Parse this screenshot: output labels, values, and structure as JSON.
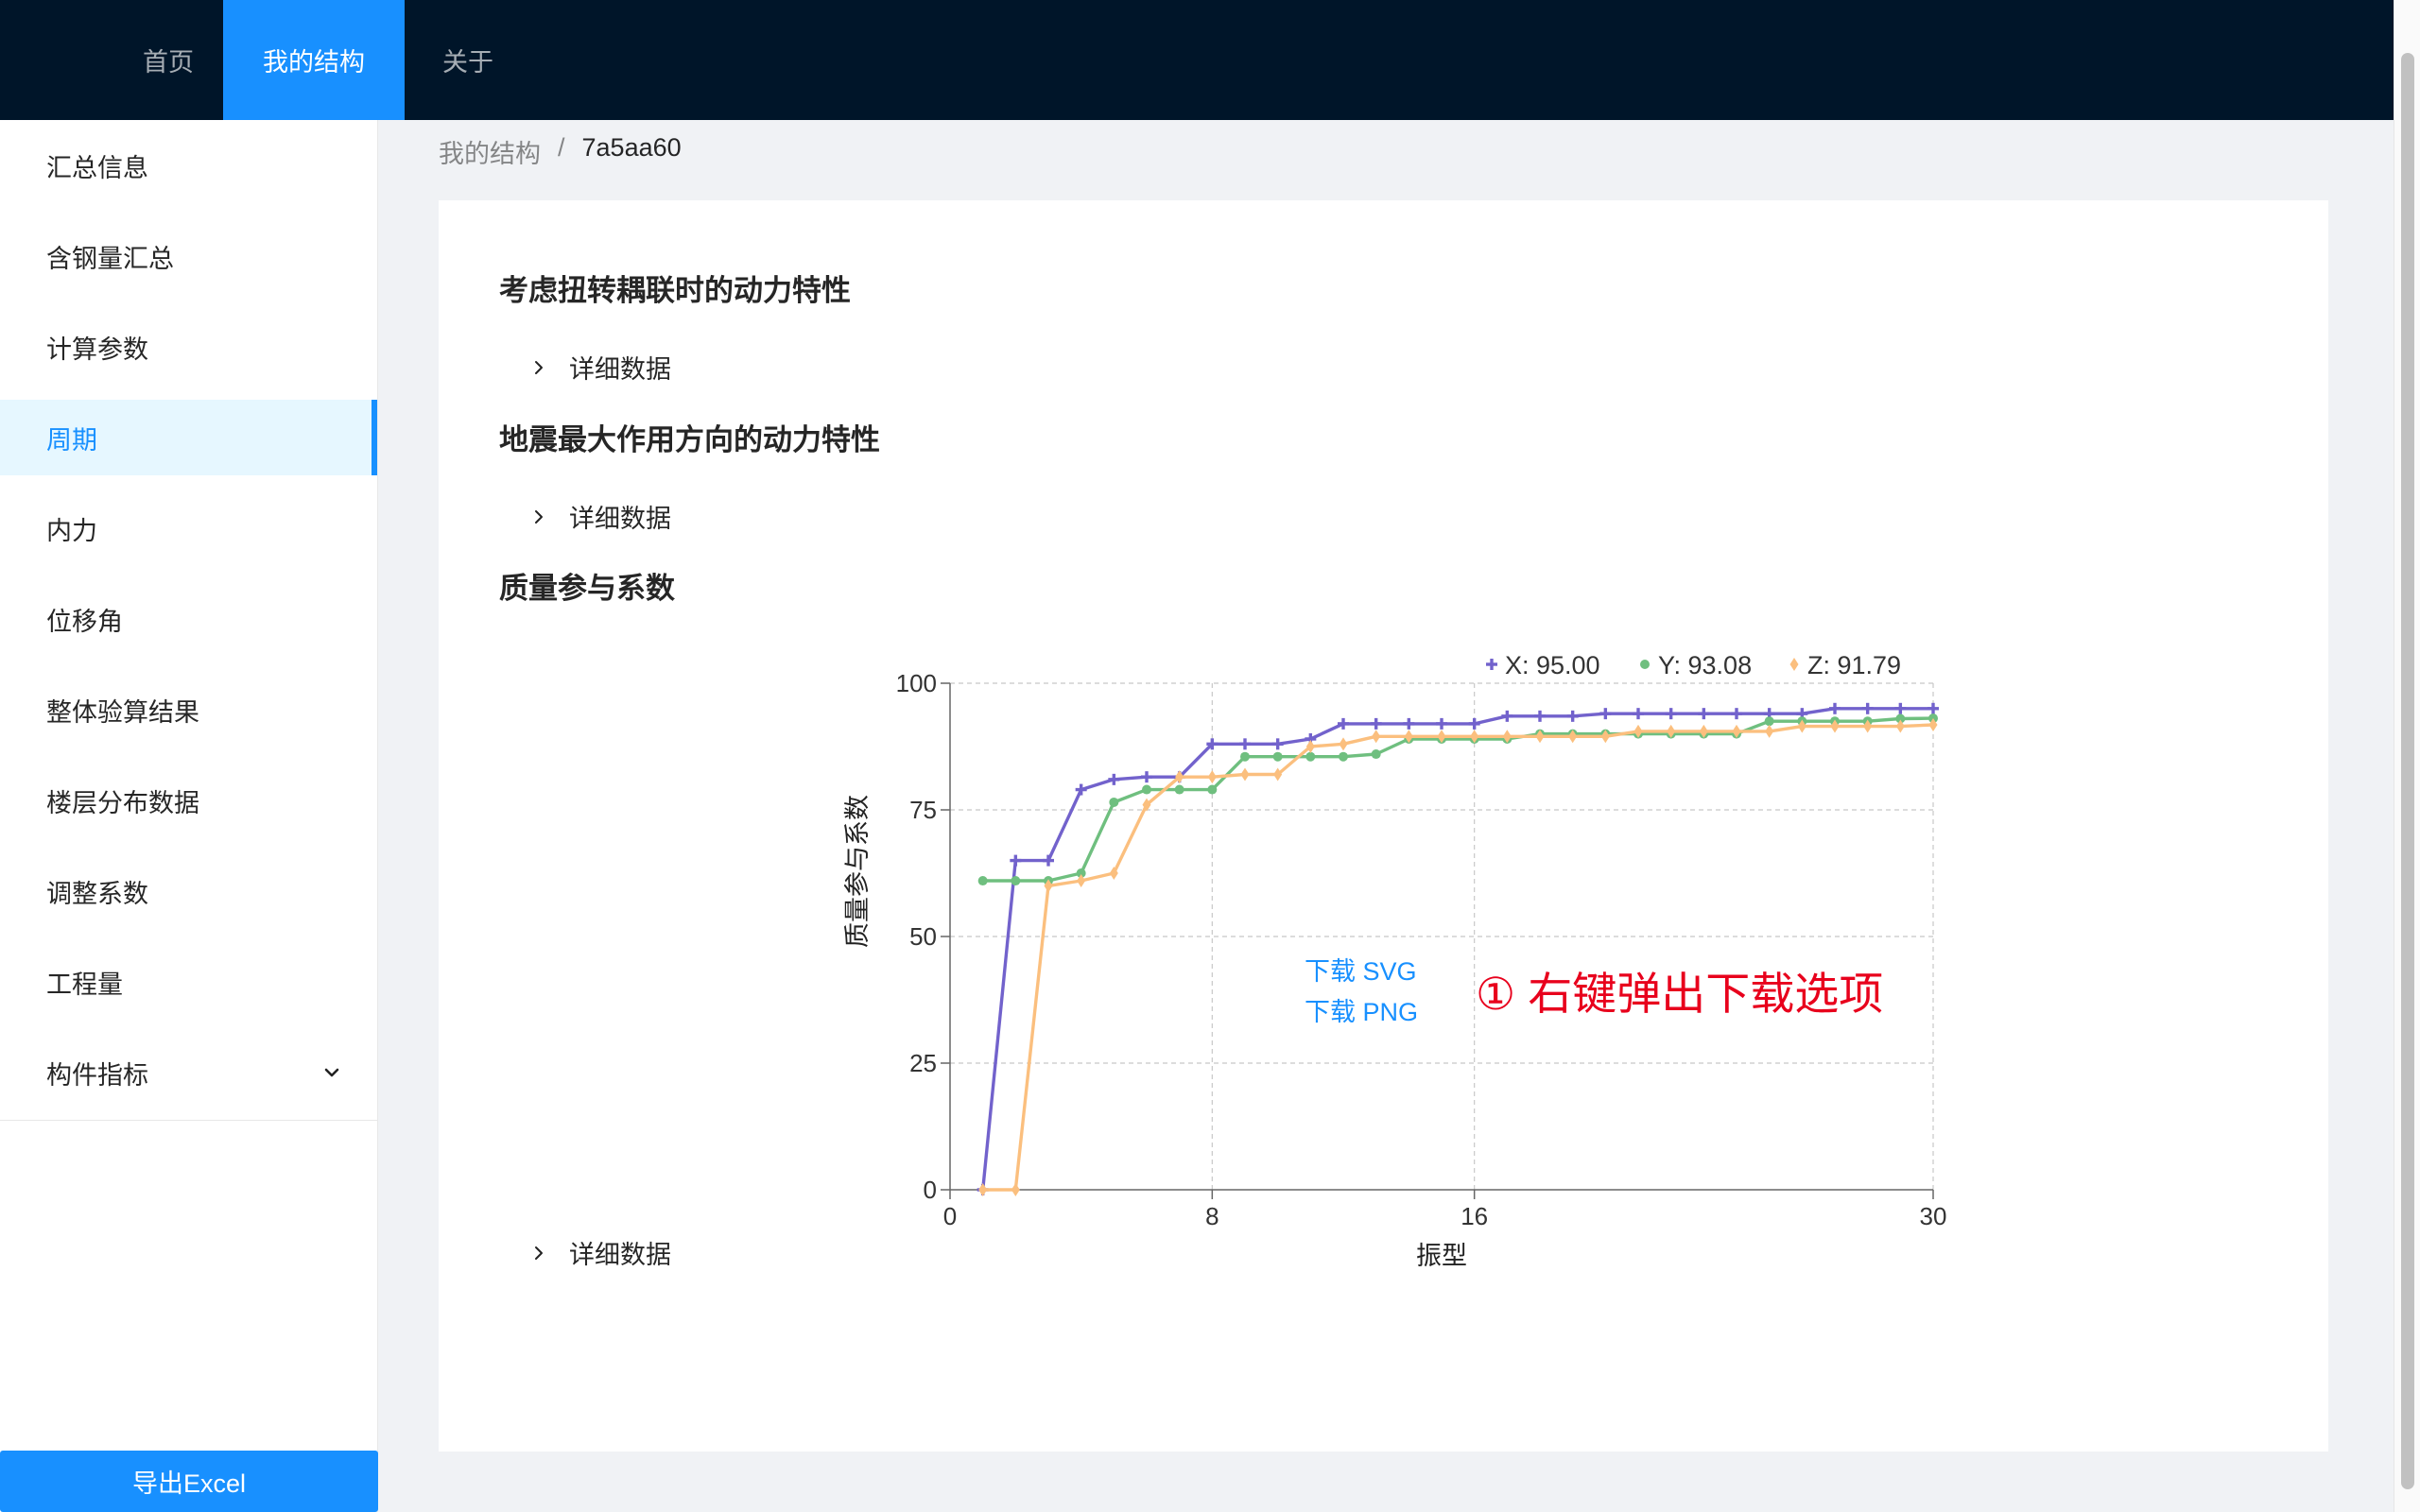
{
  "nav": {
    "home": "首页",
    "my_structure": "我的结构",
    "about": "关于"
  },
  "sidebar": {
    "items": [
      {
        "label": "汇总信息"
      },
      {
        "label": "含钢量汇总"
      },
      {
        "label": "计算参数"
      },
      {
        "label": "周期",
        "active": true
      },
      {
        "label": "内力"
      },
      {
        "label": "位移角"
      },
      {
        "label": "整体验算结果"
      },
      {
        "label": "楼层分布数据"
      },
      {
        "label": "调整系数"
      },
      {
        "label": "工程量"
      },
      {
        "label": "构件指标",
        "expandable": true
      }
    ],
    "export_label": "导出Excel"
  },
  "breadcrumb": {
    "parent": "我的结构",
    "separator": "/",
    "current": "7a5aa60"
  },
  "sections": [
    {
      "title": "考虑扭转耦联时的动力特性",
      "detail_label": "详细数据"
    },
    {
      "title": "地震最大作用方向的动力特性",
      "detail_label": "详细数据"
    },
    {
      "title": "质量参与系数",
      "detail_label": "详细数据"
    }
  ],
  "context_menu": {
    "download_svg": "下载 SVG",
    "download_png": "下载 PNG"
  },
  "annotation": "① 右键弹出下载选项",
  "colors": {
    "nav_bg": "#001529",
    "accent": "#1890ff",
    "series_x": "#7262cc",
    "series_y": "#6fbf7f",
    "series_z": "#fbbf7e",
    "annotation": "#e8001c"
  },
  "chart_data": {
    "type": "line",
    "xlabel": "振型",
    "ylabel": "质量参与系数",
    "xlim": [
      0,
      30
    ],
    "ylim": [
      0,
      100
    ],
    "x_ticks": [
      0,
      8,
      16,
      30
    ],
    "y_ticks": [
      0,
      25,
      50,
      75,
      100
    ],
    "grid": true,
    "legend_position": "top-right",
    "x": [
      1,
      2,
      3,
      4,
      5,
      6,
      7,
      8,
      9,
      10,
      11,
      12,
      13,
      14,
      15,
      16,
      17,
      18,
      19,
      20,
      21,
      22,
      23,
      24,
      25,
      26,
      27,
      28,
      29,
      30
    ],
    "series": [
      {
        "name": "X",
        "legend_label": "X: 95.00",
        "marker": "cross",
        "values": [
          0,
          65,
          65,
          79,
          81,
          81.5,
          81.5,
          88,
          88,
          88,
          89,
          92,
          92,
          92,
          92,
          92,
          93.5,
          93.5,
          93.5,
          94,
          94,
          94,
          94,
          94,
          94,
          94,
          95,
          95,
          95,
          95
        ]
      },
      {
        "name": "Y",
        "legend_label": "Y: 93.08",
        "marker": "circle",
        "values": [
          61,
          61,
          61,
          62.5,
          76.5,
          79,
          79,
          79,
          85.5,
          85.5,
          85.5,
          85.5,
          86,
          89,
          89,
          89,
          89,
          90,
          90,
          90,
          90,
          90,
          90,
          90,
          92.5,
          92.5,
          92.5,
          92.5,
          93,
          93.08
        ]
      },
      {
        "name": "Z",
        "legend_label": "Z: 91.79",
        "marker": "diamond",
        "values": [
          0,
          0,
          60,
          61,
          62.5,
          76,
          81.5,
          81.5,
          82,
          82,
          87.5,
          88,
          89.5,
          89.5,
          89.5,
          89.5,
          89.5,
          89.5,
          89.5,
          89.5,
          90.5,
          90.5,
          90.5,
          90.5,
          90.5,
          91.5,
          91.5,
          91.5,
          91.5,
          91.79
        ]
      }
    ]
  }
}
